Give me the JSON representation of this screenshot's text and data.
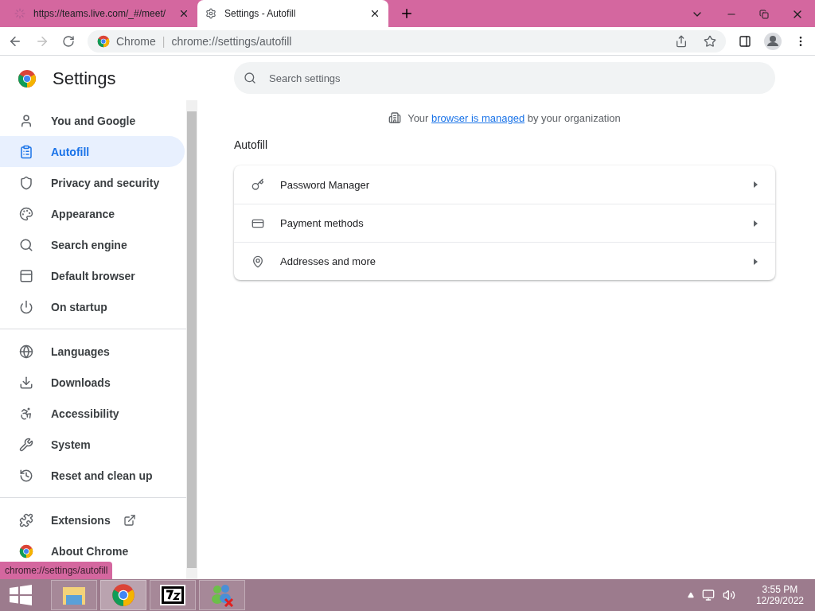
{
  "tabs": [
    {
      "title": "https://teams.live.com/_#/meet/",
      "selected": false,
      "loading": true
    },
    {
      "title": "Settings - Autofill",
      "selected": true,
      "loading": false
    }
  ],
  "toolbar": {
    "site_label": "Chrome",
    "separator": "|",
    "url": "chrome://settings/autofill"
  },
  "settings": {
    "title": "Settings",
    "search": {
      "placeholder": "Search settings"
    },
    "notice": {
      "before": "Your",
      "link": "browser is managed",
      "after": "by your organization"
    },
    "section_title": "Autofill",
    "rows": [
      {
        "label": "Password Manager"
      },
      {
        "label": "Payment methods"
      },
      {
        "label": "Addresses and more"
      }
    ]
  },
  "sidebar": {
    "groups": [
      [
        {
          "label": "You and Google",
          "selected": false
        },
        {
          "label": "Autofill",
          "selected": true
        },
        {
          "label": "Privacy and security",
          "selected": false
        },
        {
          "label": "Appearance",
          "selected": false
        },
        {
          "label": "Search engine",
          "selected": false
        },
        {
          "label": "Default browser",
          "selected": false
        },
        {
          "label": "On startup",
          "selected": false
        }
      ],
      [
        {
          "label": "Languages",
          "selected": false
        },
        {
          "label": "Downloads",
          "selected": false
        },
        {
          "label": "Accessibility",
          "selected": false
        },
        {
          "label": "System",
          "selected": false
        },
        {
          "label": "Reset and clean up",
          "selected": false
        }
      ],
      [
        {
          "label": "Extensions",
          "selected": false
        },
        {
          "label": "About Chrome",
          "selected": false
        }
      ]
    ]
  },
  "status_url": "chrome://settings/autofill",
  "taskbar": {
    "apps": [
      {
        "selected": false
      },
      {
        "selected": true
      },
      {
        "selected": false
      },
      {
        "selected": false
      }
    ],
    "time": "3:55 PM",
    "date": "12/29/2022"
  }
}
